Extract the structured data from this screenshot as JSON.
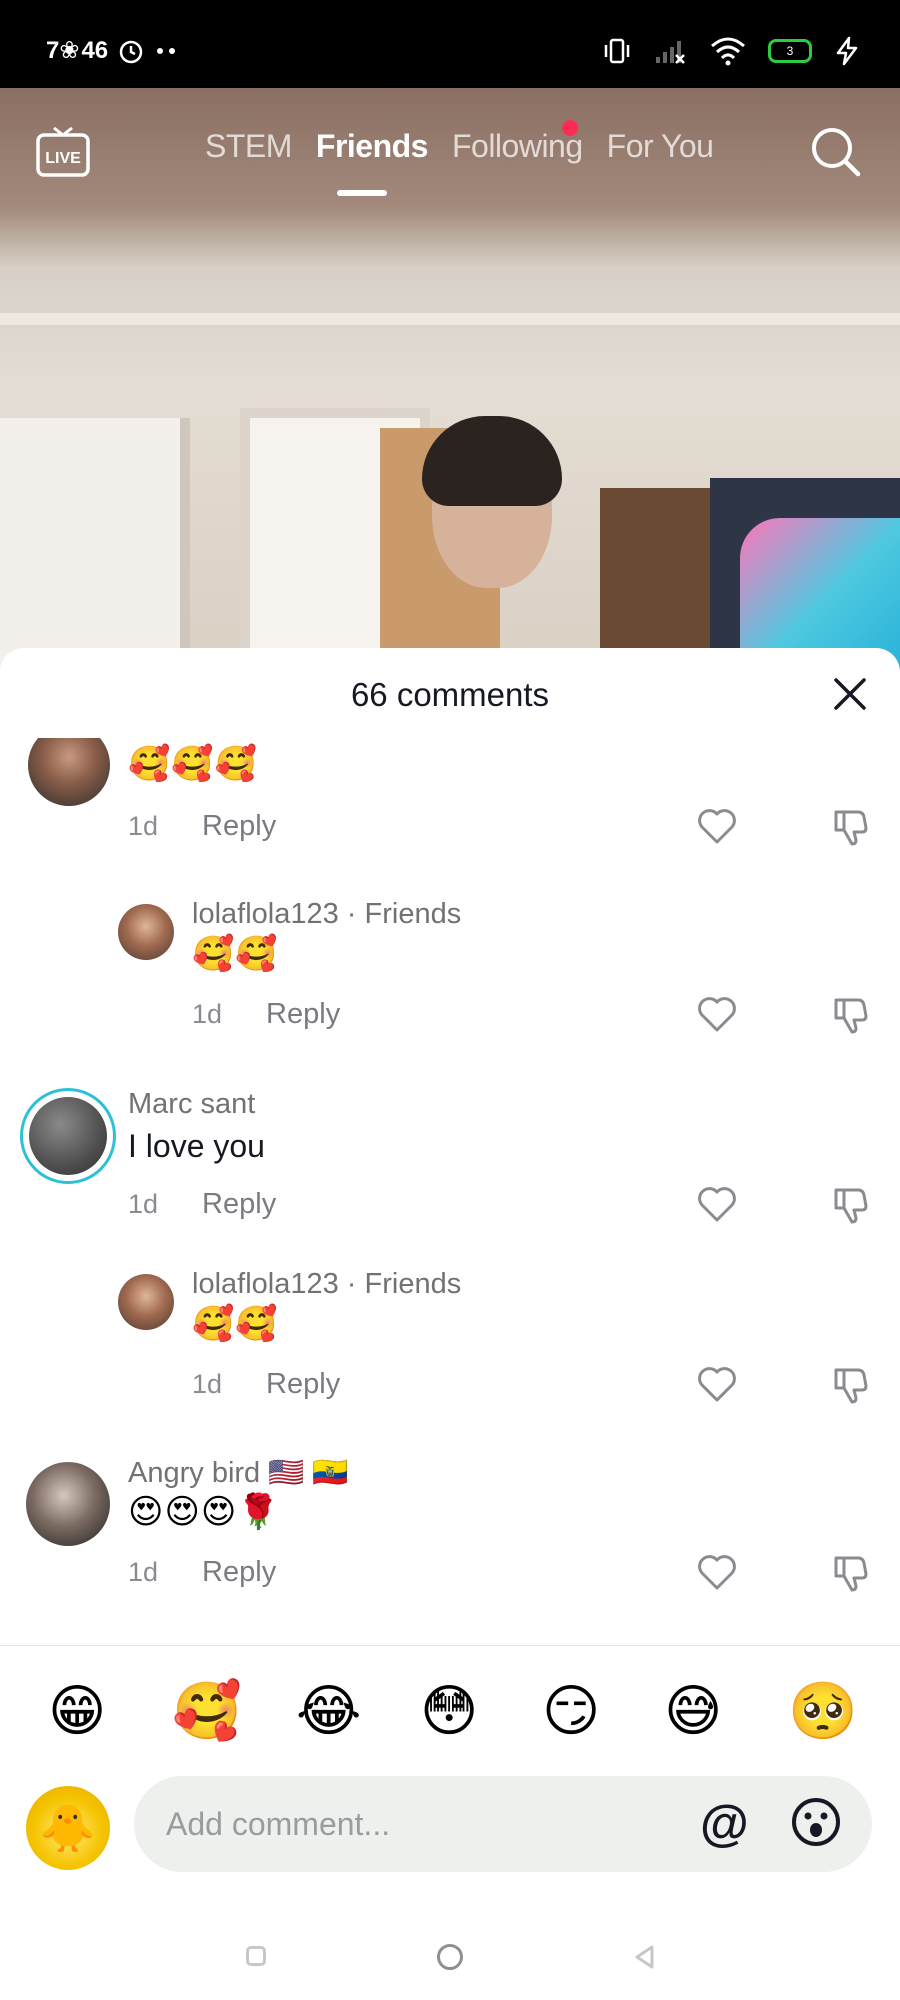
{
  "status_bar": {
    "left_text": "7❀ 46",
    "battery_level": "3",
    "icons": [
      "alarm-icon",
      "more-dots-icon",
      "vibrate-icon",
      "signal-icon",
      "wifi-icon",
      "battery-icon",
      "charging-icon"
    ]
  },
  "nav": {
    "live_label": "LIVE",
    "tabs": [
      {
        "label": "STEM",
        "active": false
      },
      {
        "label": "Friends",
        "active": true
      },
      {
        "label": "Following",
        "active": false,
        "has_dot": true
      },
      {
        "label": "For You",
        "active": false
      }
    ]
  },
  "comments_sheet": {
    "title": "66 comments",
    "comments": [
      {
        "username": "",
        "text": "🥰🥰🥰",
        "time": "1d",
        "reply_label": "Reply",
        "is_reply": false
      },
      {
        "username": "lolaflola123 · Friends",
        "text": "🥰🥰",
        "time": "1d",
        "reply_label": "Reply",
        "is_reply": true
      },
      {
        "username": "Marc sant",
        "text": "I love you",
        "time": "1d",
        "reply_label": "Reply",
        "is_reply": false
      },
      {
        "username": "lolaflola123 · Friends",
        "text": "🥰🥰",
        "time": "1d",
        "reply_label": "Reply",
        "is_reply": true
      },
      {
        "username": "Angry bird 🇺🇸 🇪🇨",
        "text": "😍😍😍🌹",
        "time": "1d",
        "reply_label": "Reply",
        "is_reply": false
      }
    ]
  },
  "quick_emojis": [
    "😁",
    "🥰",
    "😂",
    "😳",
    "😏",
    "😅",
    "🥺"
  ],
  "composer": {
    "placeholder": "Add comment...",
    "avatar_emoji": "🐥",
    "at_symbol": "@"
  },
  "colors": {
    "accent_red": "#fe2c55",
    "text_primary": "#161823",
    "text_secondary": "#8a8b91",
    "input_bg": "#eef0ed"
  }
}
